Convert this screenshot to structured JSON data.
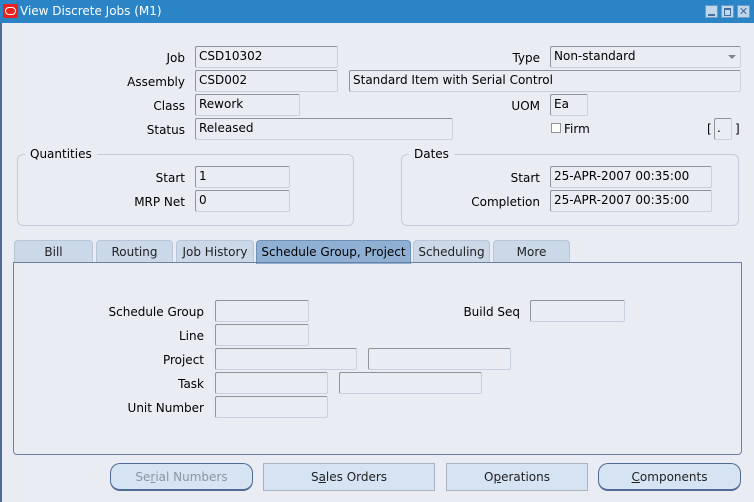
{
  "window": {
    "title": "View Discrete Jobs (M1)",
    "controls": [
      "minimize",
      "maximize",
      "close"
    ]
  },
  "header": {
    "job": {
      "label": "Job",
      "value": "CSD10302"
    },
    "assembly": {
      "label": "Assembly",
      "value": "CSD002",
      "description": "Standard Item with Serial Control"
    },
    "class": {
      "label": "Class",
      "value": "Rework"
    },
    "status": {
      "label": "Status",
      "value": "Released"
    },
    "type": {
      "label": "Type",
      "value": "Non-standard"
    },
    "uom": {
      "label": "UOM",
      "value": "Ea"
    },
    "firm": {
      "label": "Firm",
      "checked": false
    },
    "dff": {
      "open": "[",
      "value": ".",
      "close": "]"
    }
  },
  "quantities": {
    "title": "Quantities",
    "start": {
      "label": "Start",
      "value": "1"
    },
    "mrp_net": {
      "label": "MRP Net",
      "value": "0"
    }
  },
  "dates": {
    "title": "Dates",
    "start": {
      "label": "Start",
      "value": "25-APR-2007 00:35:00"
    },
    "completion": {
      "label": "Completion",
      "value": "25-APR-2007 00:35:00"
    }
  },
  "tabs": [
    {
      "label": "Bill",
      "active": false
    },
    {
      "label": "Routing",
      "active": false
    },
    {
      "label": "Job History",
      "active": false
    },
    {
      "label": "Schedule Group, Project",
      "active": true
    },
    {
      "label": "Scheduling",
      "active": false
    },
    {
      "label": "More",
      "active": false
    }
  ],
  "panel": {
    "schedule_group": {
      "label": "Schedule Group",
      "value": ""
    },
    "build_seq": {
      "label": "Build Seq",
      "value": ""
    },
    "line": {
      "label": "Line",
      "value": ""
    },
    "project": {
      "label": "Project",
      "value": "",
      "description": ""
    },
    "task": {
      "label": "Task",
      "value": "",
      "description": ""
    },
    "unit_number": {
      "label": "Unit Number",
      "value": ""
    }
  },
  "buttons": {
    "serial_numbers": {
      "pre": "Se",
      "mn": "r",
      "post": "ial Numbers",
      "enabled": false
    },
    "sales_orders": {
      "pre": "S",
      "mn": "a",
      "post": "les Orders",
      "enabled": true
    },
    "operations": {
      "pre": "O",
      "mn": "p",
      "post": "erations",
      "enabled": true
    },
    "components": {
      "pre": "",
      "mn": "C",
      "post": "omponents",
      "enabled": true
    }
  }
}
